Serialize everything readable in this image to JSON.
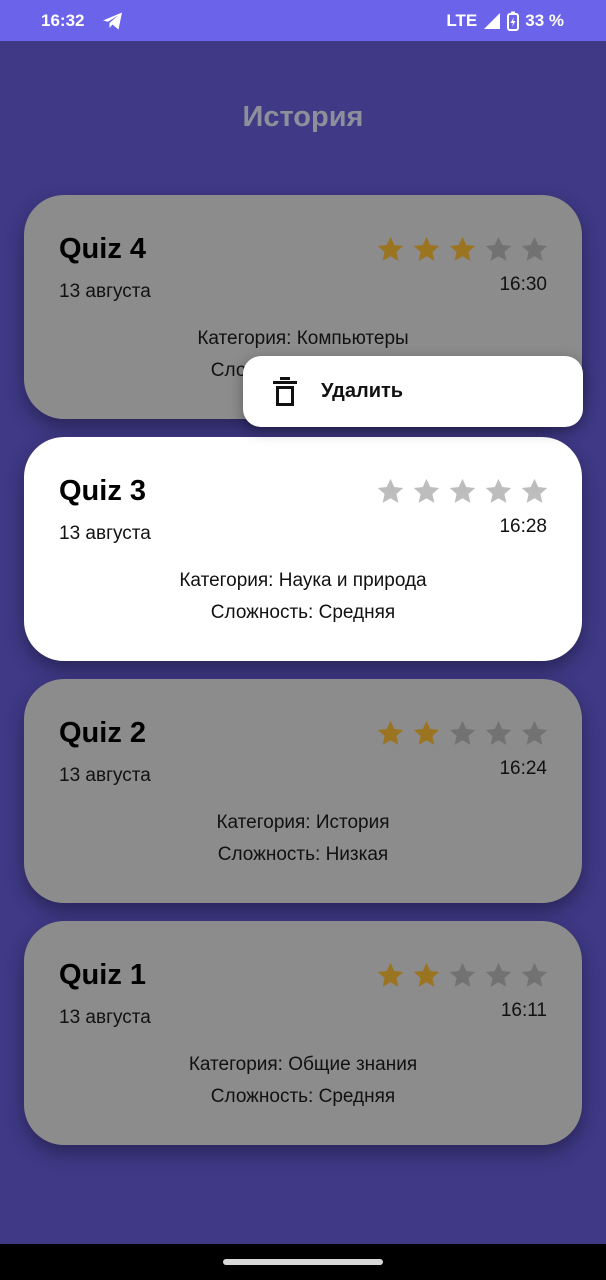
{
  "status_bar": {
    "time": "16:32",
    "telegram_icon": "telegram-icon",
    "network": "LTE",
    "battery": "33 %"
  },
  "page": {
    "title": "История"
  },
  "cards": [
    {
      "title": "Quiz 4",
      "date": "13 августа",
      "time": "16:30",
      "stars": 3,
      "max_stars": 5,
      "category": "Категория: Компьютеры",
      "difficulty": "Сложность: Средняя",
      "state": "dimmed"
    },
    {
      "title": "Quiz 3",
      "date": "13 августа",
      "time": "16:28",
      "stars": 0,
      "max_stars": 5,
      "category": "Категория: Наука и природа",
      "difficulty": "Сложность: Средняя",
      "state": "selected"
    },
    {
      "title": "Quiz 2",
      "date": "13 августа",
      "time": "16:24",
      "stars": 2,
      "max_stars": 5,
      "category": "Категория: История",
      "difficulty": "Сложность: Низкая",
      "state": "dimmed"
    },
    {
      "title": "Quiz 1",
      "date": "13 августа",
      "time": "16:11",
      "stars": 2,
      "max_stars": 5,
      "category": "Категория: Общие знания",
      "difficulty": "Сложность: Средняя",
      "state": "dimmed"
    }
  ],
  "popup_menu": {
    "delete_label": "Удалить",
    "icon": "trash-icon"
  },
  "colors": {
    "status_bar": "#6b63ea",
    "background": "#3f3986",
    "card_dimmed": "#8c8c8c",
    "card_selected": "#ffffff",
    "star_filled": "#9a7420",
    "star_empty": "#727272"
  }
}
